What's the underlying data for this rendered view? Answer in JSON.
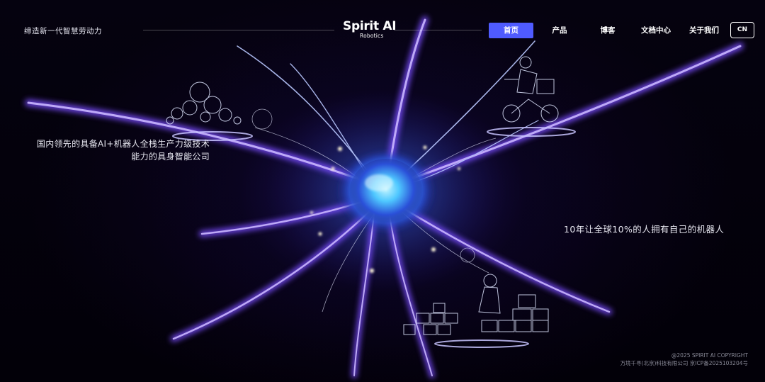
{
  "header": {
    "tagline": "缔造新一代智慧劳动力",
    "logo": {
      "main": "Spirit AI",
      "sub": "Robotics"
    },
    "nav": [
      {
        "label": "首页",
        "active": true
      },
      {
        "label": "产品",
        "active": false
      },
      {
        "label": "博客",
        "active": false
      },
      {
        "label": "文档中心",
        "active": false
      },
      {
        "label": "关于我们",
        "active": false
      }
    ],
    "language_button": "CN"
  },
  "hero": {
    "left_line1": "国内领先的具备AI+机器人全栈生产力级技术",
    "left_line2": "能力的具身智能公司",
    "right_text": "10年让全球10%的人拥有自己的机器人"
  },
  "footer": {
    "copyright": "@2025 SPIRIT AI COPYRIGHT",
    "company": "万境千寻(北京)科技有限公司 京ICP备2025103204号"
  },
  "colors": {
    "background": "#020008",
    "accent": "#4f5bff",
    "neuron_glow": "#8a6bff",
    "core_glow": "#4fc8ff"
  },
  "icons": {
    "hero_visual": "neuron-image",
    "sketch_left": "cloud-icon",
    "sketch_right": "delivery-robot-icon",
    "sketch_bottom": "blocks-robot-icon"
  }
}
